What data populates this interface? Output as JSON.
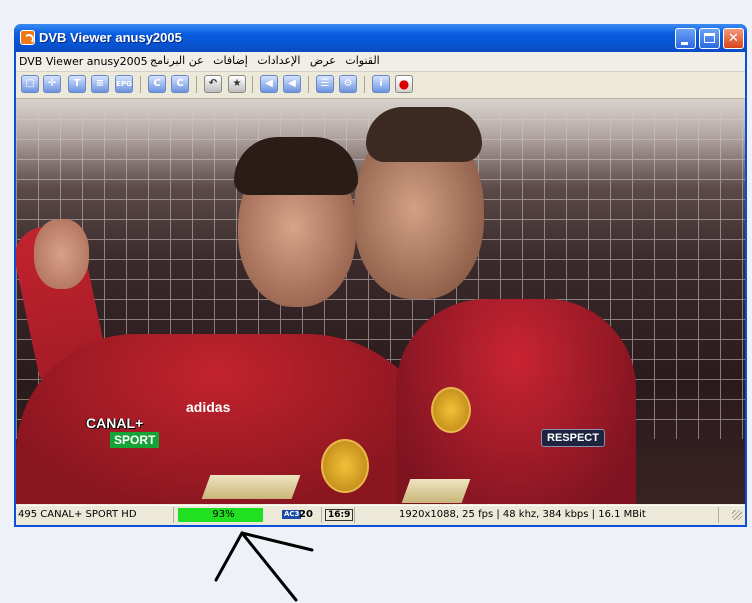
{
  "window": {
    "title": "DVB Viewer anusy2005"
  },
  "menubar": {
    "app_menu": "DVB Viewer anusy2005",
    "items": [
      "القنوات",
      "عرض",
      "الإعدادات",
      "إضافات",
      "عن البرنامج"
    ]
  },
  "toolbar": {
    "buttons": [
      {
        "icon": "window-icon"
      },
      {
        "icon": "crosshair-icon"
      },
      {
        "icon": "teletext-icon"
      },
      {
        "icon": "list-icon"
      },
      {
        "icon": "epg-icon",
        "label": "EPG"
      },
      {
        "icon": "record-back-icon"
      },
      {
        "icon": "record-forward-icon"
      },
      {
        "icon": "back-gray-icon"
      },
      {
        "icon": "favorite-icon"
      },
      {
        "icon": "previous-channel-icon"
      },
      {
        "icon": "next-channel-icon"
      },
      {
        "icon": "channel-list-icon"
      },
      {
        "icon": "settings-icon"
      },
      {
        "icon": "info-icon"
      },
      {
        "icon": "record-icon"
      }
    ]
  },
  "video": {
    "overlay_logo_top": "CANAL+",
    "overlay_logo_bottom": "SPORT",
    "shirt_brand": "adidas",
    "sleeve_patch": "RESPECT"
  },
  "status": {
    "channel": "495 CANAL+ SPORT HD",
    "signal_percent": 93,
    "signal_text": "93%",
    "audio_badge": "AC3",
    "audio_channels": "20",
    "aspect": "16:9",
    "stream_info": "1920x1088, 25 fps | 48 khz, 384 kbps | 16.1 MBit"
  },
  "colors": {
    "titlebar": "#0a5ee0",
    "signal_bar": "#21e021",
    "window_bg": "#ece9d8"
  }
}
